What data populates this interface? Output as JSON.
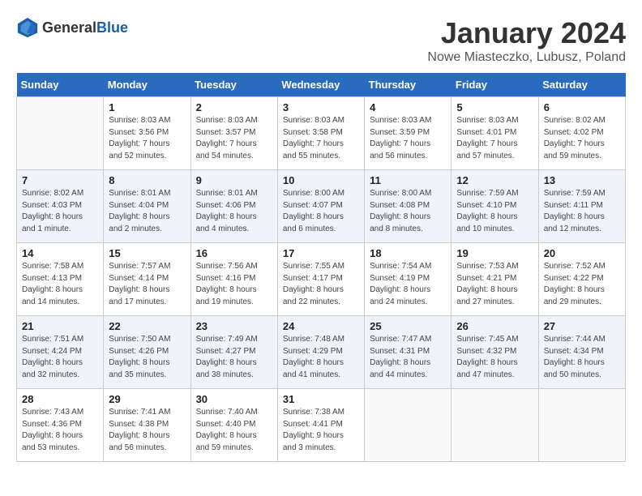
{
  "header": {
    "logo_general": "General",
    "logo_blue": "Blue",
    "month": "January 2024",
    "location": "Nowe Miasteczko, Lubusz, Poland"
  },
  "weekdays": [
    "Sunday",
    "Monday",
    "Tuesday",
    "Wednesday",
    "Thursday",
    "Friday",
    "Saturday"
  ],
  "weeks": [
    [
      {
        "day": "",
        "info": ""
      },
      {
        "day": "1",
        "info": "Sunrise: 8:03 AM\nSunset: 3:56 PM\nDaylight: 7 hours\nand 52 minutes."
      },
      {
        "day": "2",
        "info": "Sunrise: 8:03 AM\nSunset: 3:57 PM\nDaylight: 7 hours\nand 54 minutes."
      },
      {
        "day": "3",
        "info": "Sunrise: 8:03 AM\nSunset: 3:58 PM\nDaylight: 7 hours\nand 55 minutes."
      },
      {
        "day": "4",
        "info": "Sunrise: 8:03 AM\nSunset: 3:59 PM\nDaylight: 7 hours\nand 56 minutes."
      },
      {
        "day": "5",
        "info": "Sunrise: 8:03 AM\nSunset: 4:01 PM\nDaylight: 7 hours\nand 57 minutes."
      },
      {
        "day": "6",
        "info": "Sunrise: 8:02 AM\nSunset: 4:02 PM\nDaylight: 7 hours\nand 59 minutes."
      }
    ],
    [
      {
        "day": "7",
        "info": "Sunrise: 8:02 AM\nSunset: 4:03 PM\nDaylight: 8 hours\nand 1 minute."
      },
      {
        "day": "8",
        "info": "Sunrise: 8:01 AM\nSunset: 4:04 PM\nDaylight: 8 hours\nand 2 minutes."
      },
      {
        "day": "9",
        "info": "Sunrise: 8:01 AM\nSunset: 4:06 PM\nDaylight: 8 hours\nand 4 minutes."
      },
      {
        "day": "10",
        "info": "Sunrise: 8:00 AM\nSunset: 4:07 PM\nDaylight: 8 hours\nand 6 minutes."
      },
      {
        "day": "11",
        "info": "Sunrise: 8:00 AM\nSunset: 4:08 PM\nDaylight: 8 hours\nand 8 minutes."
      },
      {
        "day": "12",
        "info": "Sunrise: 7:59 AM\nSunset: 4:10 PM\nDaylight: 8 hours\nand 10 minutes."
      },
      {
        "day": "13",
        "info": "Sunrise: 7:59 AM\nSunset: 4:11 PM\nDaylight: 8 hours\nand 12 minutes."
      }
    ],
    [
      {
        "day": "14",
        "info": "Sunrise: 7:58 AM\nSunset: 4:13 PM\nDaylight: 8 hours\nand 14 minutes."
      },
      {
        "day": "15",
        "info": "Sunrise: 7:57 AM\nSunset: 4:14 PM\nDaylight: 8 hours\nand 17 minutes."
      },
      {
        "day": "16",
        "info": "Sunrise: 7:56 AM\nSunset: 4:16 PM\nDaylight: 8 hours\nand 19 minutes."
      },
      {
        "day": "17",
        "info": "Sunrise: 7:55 AM\nSunset: 4:17 PM\nDaylight: 8 hours\nand 22 minutes."
      },
      {
        "day": "18",
        "info": "Sunrise: 7:54 AM\nSunset: 4:19 PM\nDaylight: 8 hours\nand 24 minutes."
      },
      {
        "day": "19",
        "info": "Sunrise: 7:53 AM\nSunset: 4:21 PM\nDaylight: 8 hours\nand 27 minutes."
      },
      {
        "day": "20",
        "info": "Sunrise: 7:52 AM\nSunset: 4:22 PM\nDaylight: 8 hours\nand 29 minutes."
      }
    ],
    [
      {
        "day": "21",
        "info": "Sunrise: 7:51 AM\nSunset: 4:24 PM\nDaylight: 8 hours\nand 32 minutes."
      },
      {
        "day": "22",
        "info": "Sunrise: 7:50 AM\nSunset: 4:26 PM\nDaylight: 8 hours\nand 35 minutes."
      },
      {
        "day": "23",
        "info": "Sunrise: 7:49 AM\nSunset: 4:27 PM\nDaylight: 8 hours\nand 38 minutes."
      },
      {
        "day": "24",
        "info": "Sunrise: 7:48 AM\nSunset: 4:29 PM\nDaylight: 8 hours\nand 41 minutes."
      },
      {
        "day": "25",
        "info": "Sunrise: 7:47 AM\nSunset: 4:31 PM\nDaylight: 8 hours\nand 44 minutes."
      },
      {
        "day": "26",
        "info": "Sunrise: 7:45 AM\nSunset: 4:32 PM\nDaylight: 8 hours\nand 47 minutes."
      },
      {
        "day": "27",
        "info": "Sunrise: 7:44 AM\nSunset: 4:34 PM\nDaylight: 8 hours\nand 50 minutes."
      }
    ],
    [
      {
        "day": "28",
        "info": "Sunrise: 7:43 AM\nSunset: 4:36 PM\nDaylight: 8 hours\nand 53 minutes."
      },
      {
        "day": "29",
        "info": "Sunrise: 7:41 AM\nSunset: 4:38 PM\nDaylight: 8 hours\nand 56 minutes."
      },
      {
        "day": "30",
        "info": "Sunrise: 7:40 AM\nSunset: 4:40 PM\nDaylight: 8 hours\nand 59 minutes."
      },
      {
        "day": "31",
        "info": "Sunrise: 7:38 AM\nSunset: 4:41 PM\nDaylight: 9 hours\nand 3 minutes."
      },
      {
        "day": "",
        "info": ""
      },
      {
        "day": "",
        "info": ""
      },
      {
        "day": "",
        "info": ""
      }
    ]
  ]
}
